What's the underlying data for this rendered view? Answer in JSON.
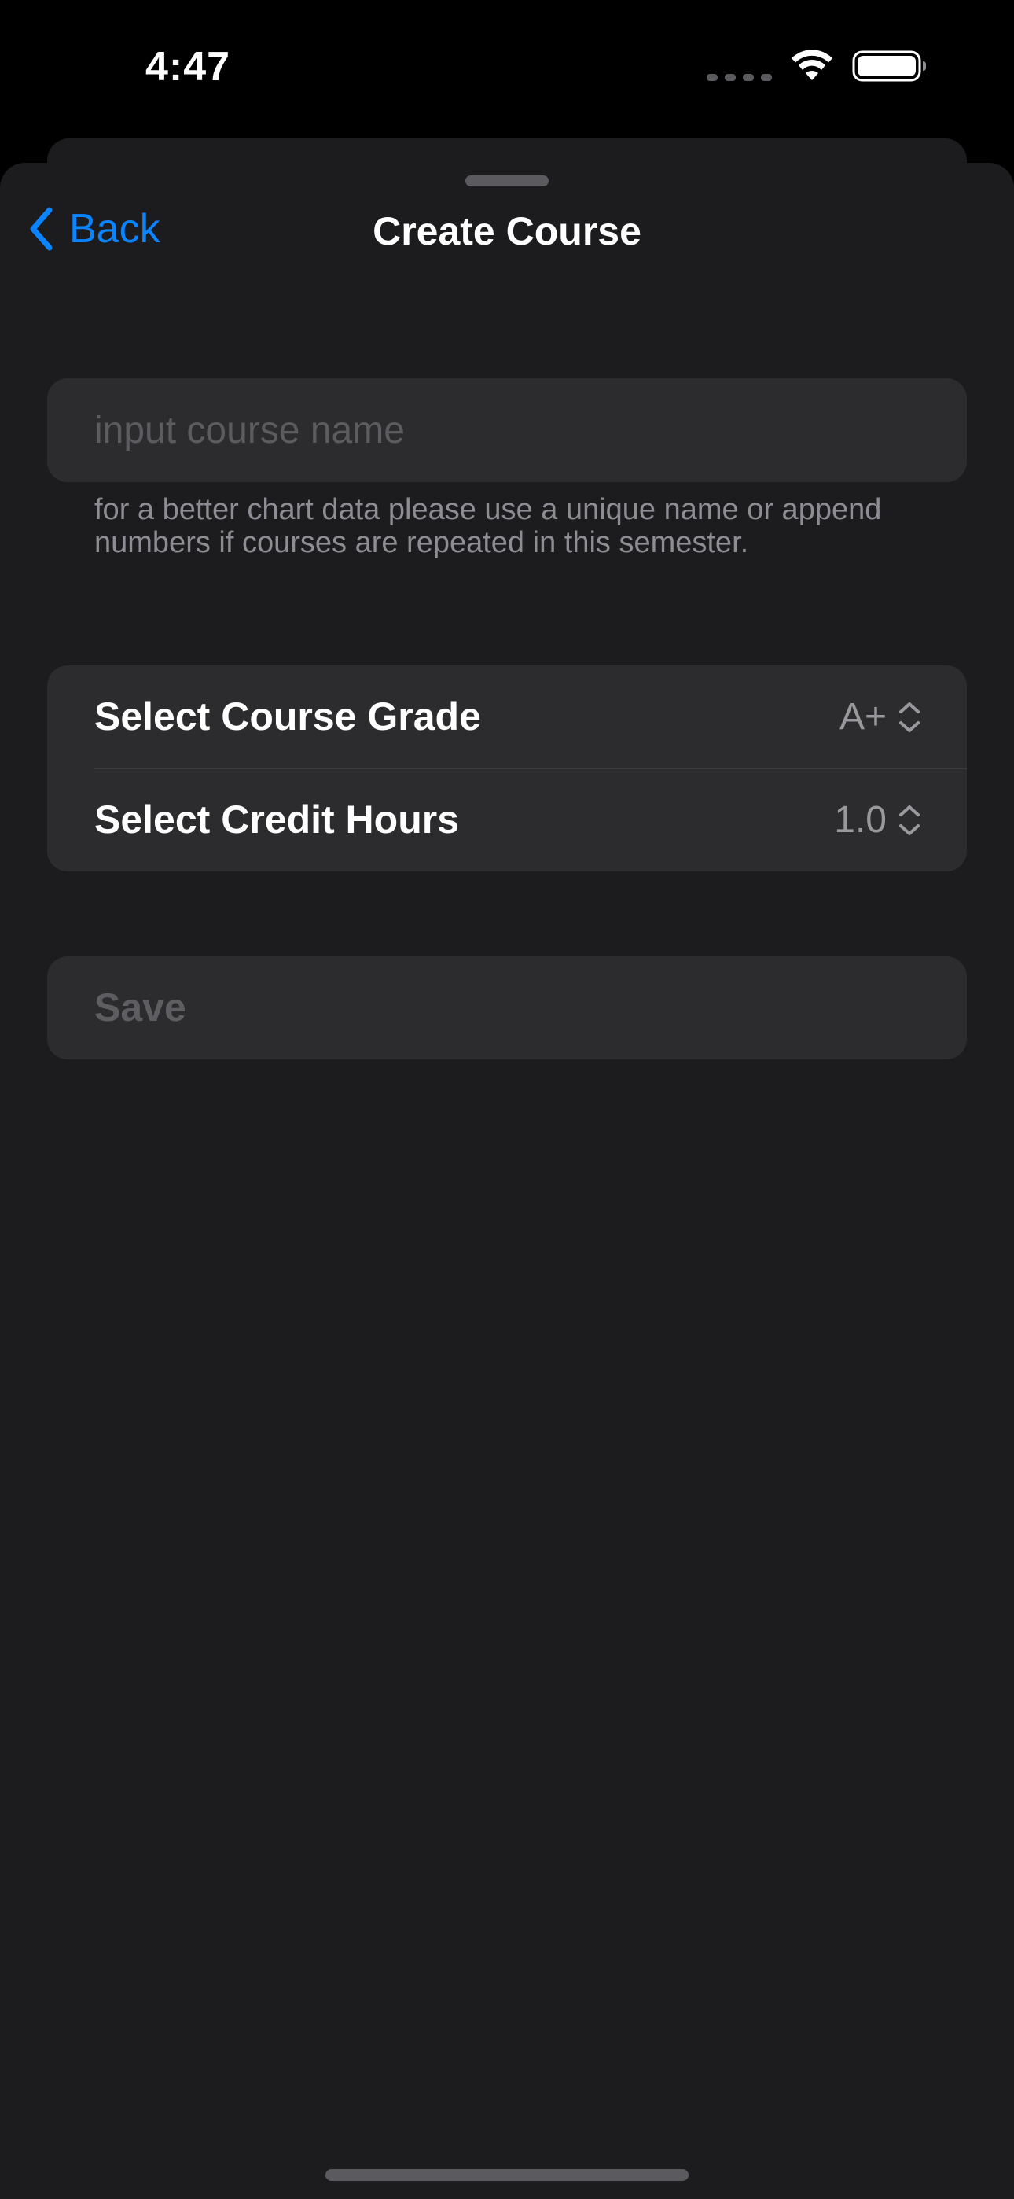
{
  "status_bar": {
    "time": "4:47",
    "wifi_icon": "wifi-icon",
    "battery_icon": "battery-icon",
    "signal_icon": "cellular-signal-icon"
  },
  "nav": {
    "back_label": "Back",
    "back_icon": "chevron-left-icon",
    "title": "Create Course"
  },
  "form": {
    "course_name": {
      "value": "",
      "placeholder": "input course name"
    },
    "footnote": "for a better chart data please use a unique name or append numbers if courses are repeated in this semester.",
    "grade": {
      "label": "Select Course Grade",
      "value": "A+",
      "icon": "chevron-up-down-icon"
    },
    "credit_hours": {
      "label": "Select Credit Hours",
      "value": "1.0",
      "icon": "chevron-up-down-icon"
    },
    "save_label": "Save"
  },
  "colors": {
    "accent": "#0a84ff",
    "sheet_background": "#1c1c1e",
    "card_background": "#2c2c2e",
    "disabled_text": "#5e5e62"
  }
}
